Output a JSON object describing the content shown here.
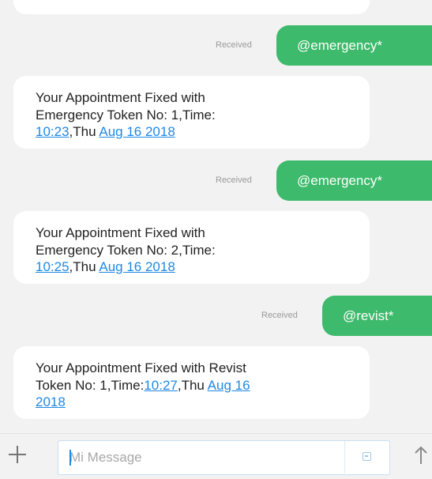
{
  "messages": [
    {
      "type": "sent",
      "text": "@emergency*",
      "status": "Received"
    },
    {
      "type": "received",
      "line1": "Your Appointment Fixed with",
      "line2": "Emergency Token No: 1,Time:",
      "time": "10:23",
      "day": ",Thu ",
      "date": "Aug 16 2018"
    },
    {
      "type": "sent",
      "text": "@emergency*",
      "status": "Received"
    },
    {
      "type": "received",
      "line1": "Your Appointment Fixed with",
      "line2": "Emergency Token No: 2,Time:",
      "time": "10:25",
      "day": ",Thu ",
      "date": "Aug 16 2018"
    },
    {
      "type": "sent",
      "text": "@revist*",
      "status": "Received"
    },
    {
      "type": "received",
      "line1": "Your Appointment Fixed with Revist",
      "line2": "Token No: 1,Time:",
      "time": "10:27",
      "day": ",Thu ",
      "date": "Aug 16",
      "date_cont": "2018"
    }
  ],
  "composer": {
    "placeholder": "Mi Message",
    "value": ""
  },
  "icons": {
    "add": "plus-icon",
    "attach": "attach-icon",
    "send": "send-arrow-icon"
  },
  "colors": {
    "sent_bubble": "#3dba6b",
    "link": "#1e88e5",
    "background": "#f2f2f2",
    "received_bubble": "#ffffff"
  }
}
